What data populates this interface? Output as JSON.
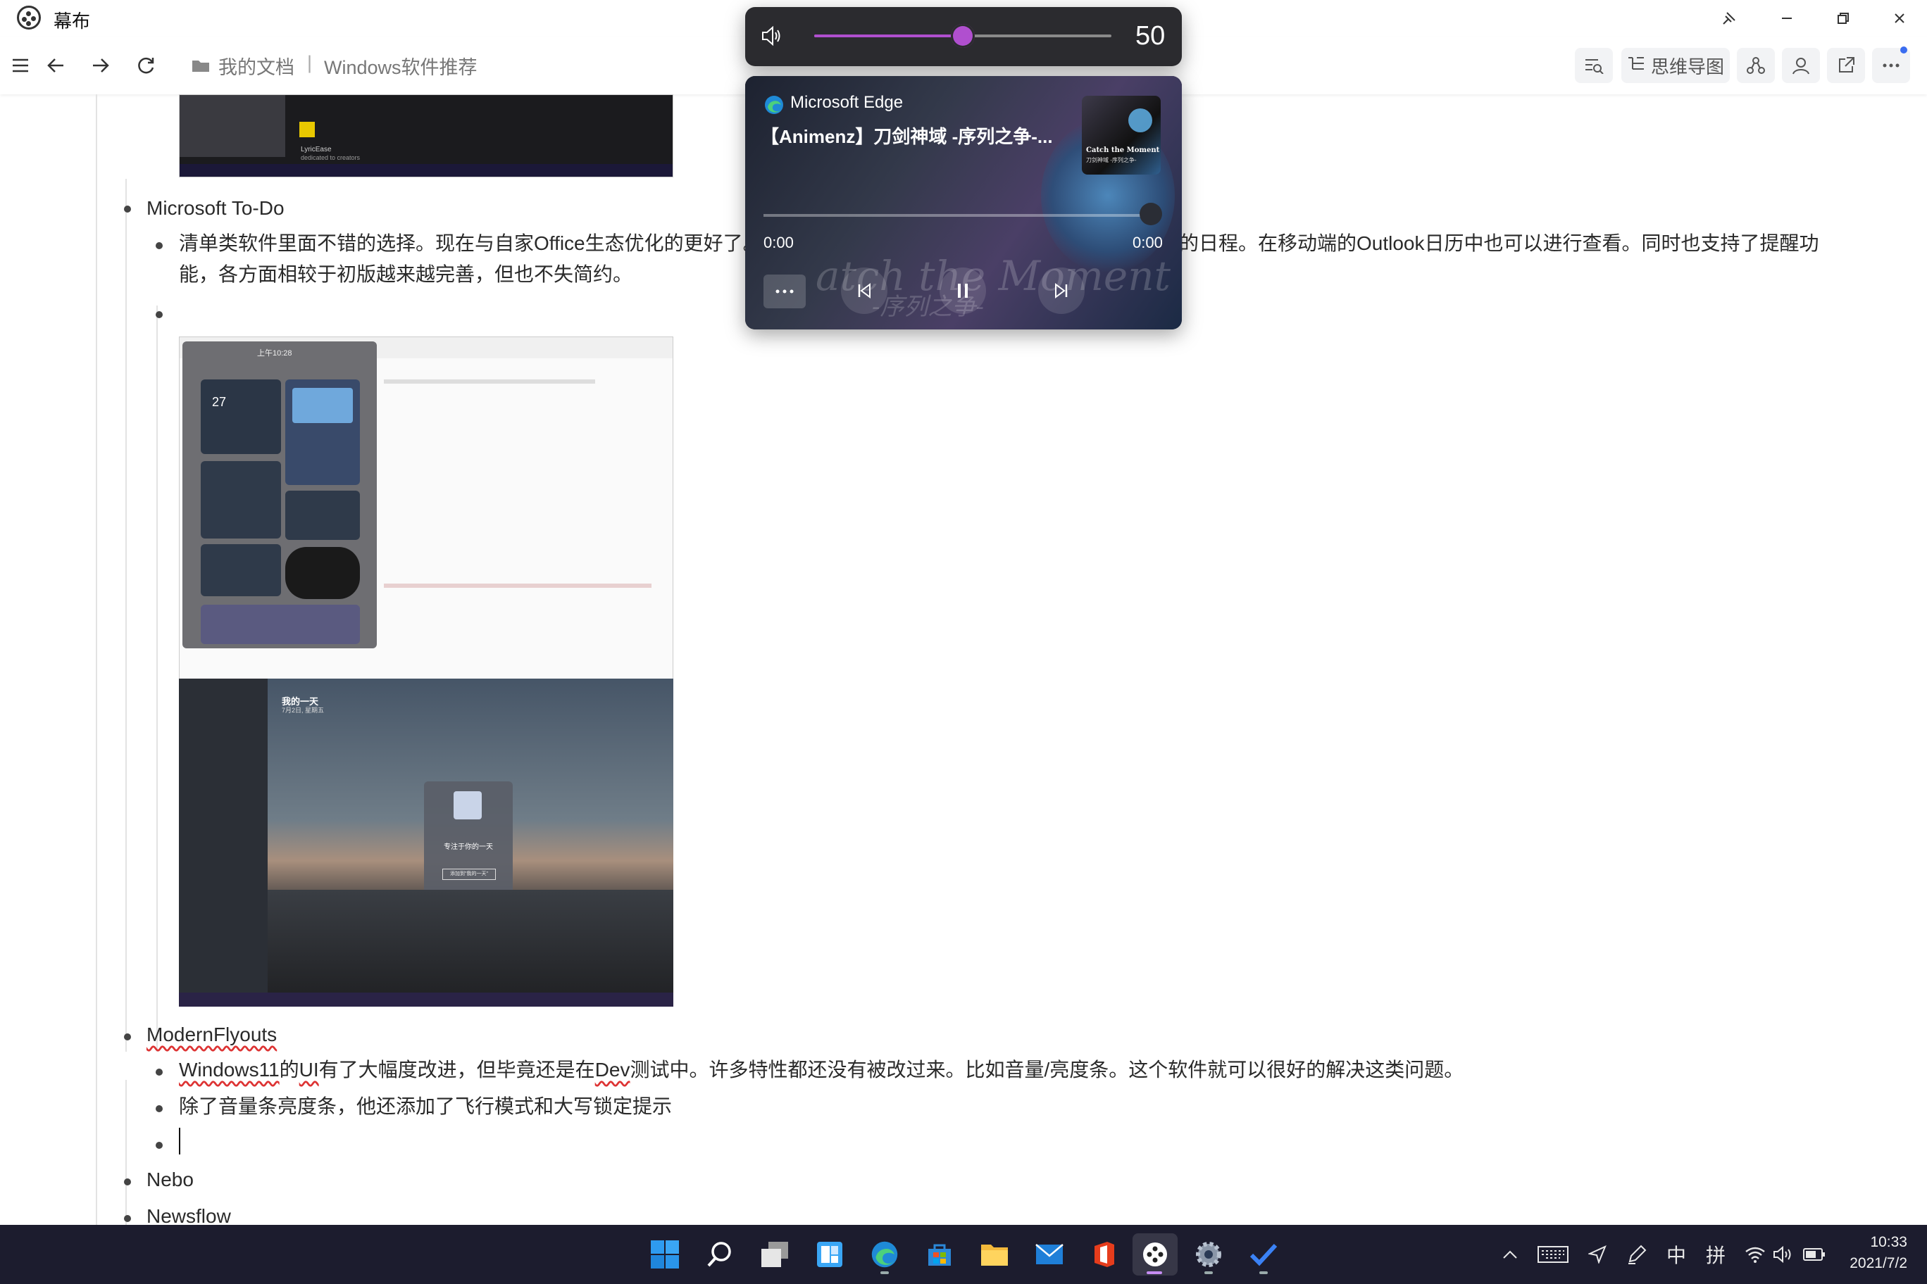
{
  "app": {
    "title": "幕布"
  },
  "toolbar": {
    "breadcrumb_folder": "我的文档",
    "breadcrumb_sep": "|",
    "breadcrumb_doc": "Windows软件推荐",
    "mindmap_label": "思维导图"
  },
  "doc": {
    "items": {
      "todo": "Microsoft To-Do",
      "todo_desc_line1": "清单类软件里面不错的选择。现在与自家Office生态优化的更好了。",
      "todo_desc_line1_tail": "的日程。在移动端的Outlook日历中也可以进行查看。同时也支持了提醒功",
      "todo_desc_line2": "能，各方面相较于初版越来越完善，但也不失简约。",
      "modernflyouts": "ModernFlyouts",
      "mf_desc1_a": "Windows11",
      "mf_desc1_b": "的",
      "mf_desc1_c": "UI",
      "mf_desc1_d": "有了大幅度改进，但毕竟还是在",
      "mf_desc1_e": "Dev",
      "mf_desc1_f": "测试中。许多特性都还没有被改过来。比如音量/亮度条。这个软件就可以很好的解决这类问题。",
      "mf_desc2": "除了音量条亮度条，他还添加了飞行模式和大写锁定提示",
      "nebo": "Nebo",
      "newsflow": "Newsflow"
    },
    "screens": {
      "top_caption": "LyricEase",
      "top_caption2": "dedicated to creators",
      "widget_time": "上午10:28",
      "widget_temp": "27",
      "todo_title": "我的一天",
      "todo_sub": "7月2日, 星期五",
      "todo_card_title": "专注于你的一天",
      "todo_card_btn": "添加到\"我的一天\"",
      "card_photo_text": "Catch the Moment"
    }
  },
  "volume": {
    "level": 50,
    "level_label": "50",
    "accent": "#b04fcf"
  },
  "media": {
    "app": "Microsoft Edge",
    "title": "【Animenz】刀剑神域 -序列之争-...",
    "elapsed": "0:00",
    "total": "0:00",
    "art_text": "Catch the Moment",
    "art_sub": "刀剑神域 -序列之争-",
    "ghost_text": "atch the Moment",
    "ghost_sub": "-序列之争-"
  },
  "taskbar": {
    "apps": [
      "start-icon",
      "search-icon",
      "task-view-icon",
      "widgets-icon",
      "edge-icon",
      "store-icon",
      "file-explorer-icon",
      "mail-icon",
      "office-icon",
      "mubu-icon",
      "settings-icon",
      "todo-icon"
    ],
    "ime_mode": "中",
    "ime_layout": "拼",
    "time": "10:33",
    "date": "2021/7/2"
  }
}
